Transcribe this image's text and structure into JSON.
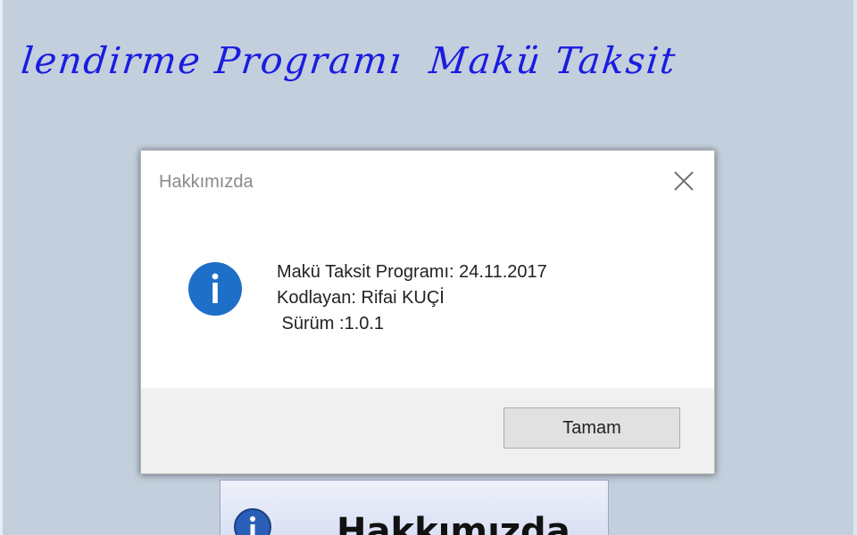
{
  "banner": {
    "text": "lendirme Programı  Makü Taksit"
  },
  "dialog": {
    "title": "Hakkımızda",
    "close_icon": "close-icon",
    "info_icon": "info-icon",
    "message_lines": [
      "Makü Taksit Programı: 24.11.2017",
      "Kodlayan: Rifai KUÇİ",
      " Sürüm :1.0.1"
    ],
    "ok_label": "Tamam"
  },
  "background_button": {
    "label": "Hakkımızda",
    "icon": "info-icon"
  },
  "colors": {
    "background": "#c3cfdd",
    "banner_text": "#1a1ce0",
    "info_icon": "#1d6fc7",
    "footer": "#f0f0f0"
  }
}
